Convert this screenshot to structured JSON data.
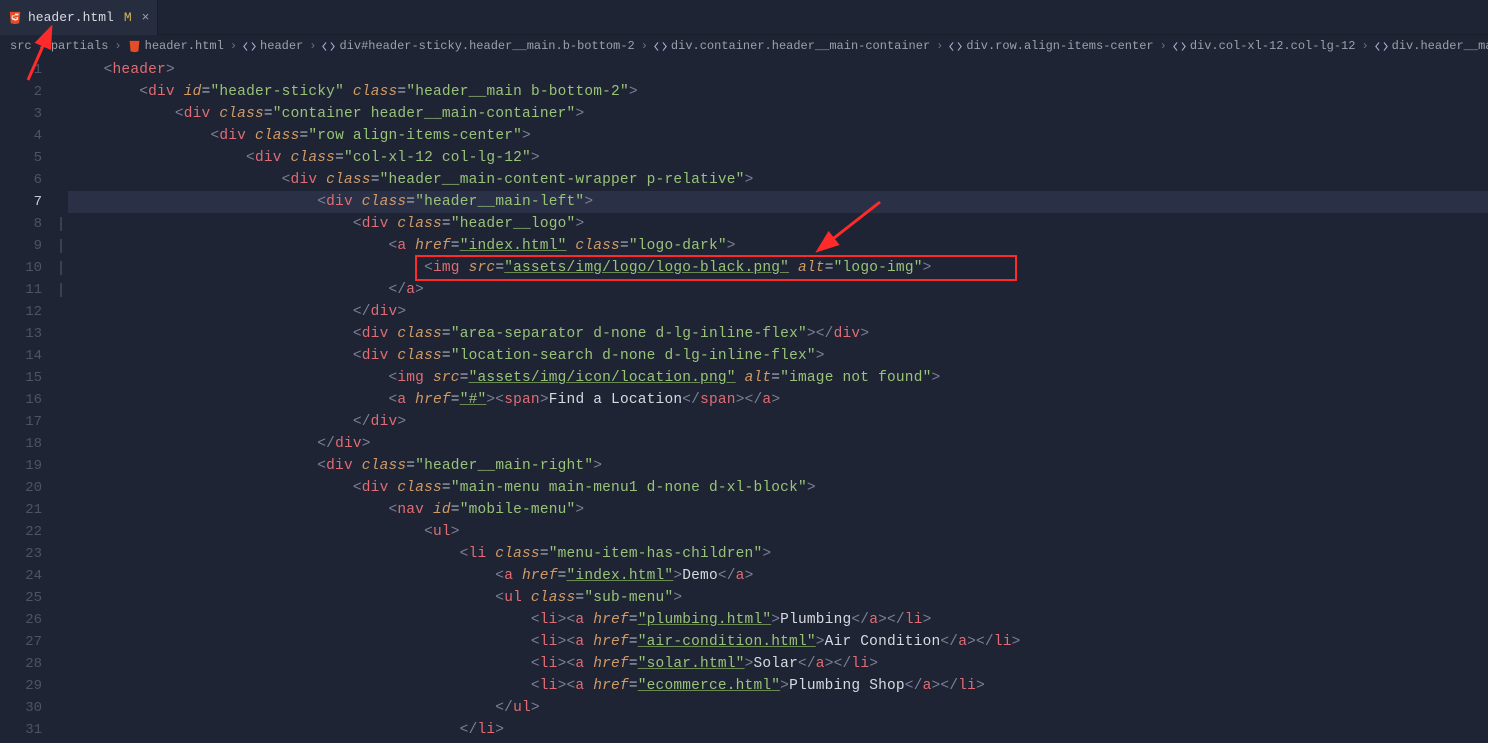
{
  "tab": {
    "filename": "header.html",
    "modified_flag": "M",
    "close_glyph": "×"
  },
  "breadcrumb": {
    "items": [
      {
        "label": "src",
        "icon": ""
      },
      {
        "label": "partials",
        "icon": ""
      },
      {
        "label": "header.html",
        "icon": "html"
      },
      {
        "label": "header",
        "icon": "tag"
      },
      {
        "label": "div#header-sticky.header__main.b-bottom-2",
        "icon": "tag"
      },
      {
        "label": "div.container.header__main-container",
        "icon": "tag"
      },
      {
        "label": "div.row.align-items-center",
        "icon": "tag"
      },
      {
        "label": "div.col-xl-12.col-lg-12",
        "icon": "tag"
      },
      {
        "label": "div.header__main-content-wrapper.p-relative",
        "icon": "tag"
      },
      {
        "label": "d",
        "icon": "tag"
      }
    ]
  },
  "code": [
    {
      "n": 1,
      "indent": 1,
      "tokens": [
        [
          "angle",
          "<"
        ],
        [
          "tag",
          "header"
        ],
        [
          "angle",
          ">"
        ]
      ]
    },
    {
      "n": 2,
      "indent": 2,
      "tokens": [
        [
          "angle",
          "<"
        ],
        [
          "tag",
          "div"
        ],
        [
          "text",
          " "
        ],
        [
          "attr",
          "id"
        ],
        [
          "eq",
          "="
        ],
        [
          "str",
          "\"header-sticky\""
        ],
        [
          "text",
          " "
        ],
        [
          "attr",
          "class"
        ],
        [
          "eq",
          "="
        ],
        [
          "str",
          "\"header__main b-bottom-2\""
        ],
        [
          "angle",
          ">"
        ]
      ]
    },
    {
      "n": 3,
      "indent": 3,
      "tokens": [
        [
          "angle",
          "<"
        ],
        [
          "tag",
          "div"
        ],
        [
          "text",
          " "
        ],
        [
          "attr",
          "class"
        ],
        [
          "eq",
          "="
        ],
        [
          "str",
          "\"container header__main-container\""
        ],
        [
          "angle",
          ">"
        ]
      ]
    },
    {
      "n": 4,
      "indent": 4,
      "tokens": [
        [
          "angle",
          "<"
        ],
        [
          "tag",
          "div"
        ],
        [
          "text",
          " "
        ],
        [
          "attr",
          "class"
        ],
        [
          "eq",
          "="
        ],
        [
          "str",
          "\"row align-items-center\""
        ],
        [
          "angle",
          ">"
        ]
      ]
    },
    {
      "n": 5,
      "indent": 5,
      "tokens": [
        [
          "angle",
          "<"
        ],
        [
          "tag",
          "div"
        ],
        [
          "text",
          " "
        ],
        [
          "attr",
          "class"
        ],
        [
          "eq",
          "="
        ],
        [
          "str",
          "\"col-xl-12 col-lg-12\""
        ],
        [
          "angle",
          ">"
        ]
      ]
    },
    {
      "n": 6,
      "indent": 6,
      "tokens": [
        [
          "angle",
          "<"
        ],
        [
          "tag",
          "div"
        ],
        [
          "text",
          " "
        ],
        [
          "attr",
          "class"
        ],
        [
          "eq",
          "="
        ],
        [
          "str",
          "\"header__main-content-wrapper p-relative\""
        ],
        [
          "angle",
          ">"
        ]
      ]
    },
    {
      "n": 7,
      "indent": 7,
      "hl": true,
      "tokens": [
        [
          "angle",
          "<"
        ],
        [
          "tag",
          "div"
        ],
        [
          "text",
          " "
        ],
        [
          "attr",
          "class"
        ],
        [
          "eq",
          "="
        ],
        [
          "str",
          "\"header__main-left\""
        ],
        [
          "angle",
          ">"
        ]
      ]
    },
    {
      "n": 8,
      "indent": 8,
      "fold": true,
      "tokens": [
        [
          "angle",
          "<"
        ],
        [
          "tag",
          "div"
        ],
        [
          "text",
          " "
        ],
        [
          "attr",
          "class"
        ],
        [
          "eq",
          "="
        ],
        [
          "str",
          "\"header__logo\""
        ],
        [
          "angle",
          ">"
        ]
      ]
    },
    {
      "n": 9,
      "indent": 9,
      "fold": true,
      "tokens": [
        [
          "angle",
          "<"
        ],
        [
          "tag",
          "a"
        ],
        [
          "text",
          " "
        ],
        [
          "attr",
          "href"
        ],
        [
          "eq",
          "="
        ],
        [
          "stru",
          "\"index.html\""
        ],
        [
          "text",
          " "
        ],
        [
          "attr",
          "class"
        ],
        [
          "eq",
          "="
        ],
        [
          "str",
          "\"logo-dark\""
        ],
        [
          "angle",
          ">"
        ]
      ]
    },
    {
      "n": 10,
      "indent": 10,
      "fold": true,
      "tokens": [
        [
          "angle",
          "<"
        ],
        [
          "tag",
          "img"
        ],
        [
          "text",
          " "
        ],
        [
          "attr",
          "src"
        ],
        [
          "eq",
          "="
        ],
        [
          "stru",
          "\"assets/img/logo/logo-black.png\""
        ],
        [
          "text",
          " "
        ],
        [
          "attr",
          "alt"
        ],
        [
          "eq",
          "="
        ],
        [
          "str",
          "\"logo-img\""
        ],
        [
          "angle",
          ">"
        ]
      ]
    },
    {
      "n": 11,
      "indent": 9,
      "fold": true,
      "tokens": [
        [
          "angle",
          "</"
        ],
        [
          "tag",
          "a"
        ],
        [
          "angle",
          ">"
        ]
      ]
    },
    {
      "n": 12,
      "indent": 8,
      "tokens": [
        [
          "angle",
          "</"
        ],
        [
          "tag",
          "div"
        ],
        [
          "angle",
          ">"
        ]
      ]
    },
    {
      "n": 13,
      "indent": 8,
      "tokens": [
        [
          "angle",
          "<"
        ],
        [
          "tag",
          "div"
        ],
        [
          "text",
          " "
        ],
        [
          "attr",
          "class"
        ],
        [
          "eq",
          "="
        ],
        [
          "str",
          "\"area-separator d-none d-lg-inline-flex\""
        ],
        [
          "angle",
          "></"
        ],
        [
          "tag",
          "div"
        ],
        [
          "angle",
          ">"
        ]
      ]
    },
    {
      "n": 14,
      "indent": 8,
      "tokens": [
        [
          "angle",
          "<"
        ],
        [
          "tag",
          "div"
        ],
        [
          "text",
          " "
        ],
        [
          "attr",
          "class"
        ],
        [
          "eq",
          "="
        ],
        [
          "str",
          "\"location-search d-none d-lg-inline-flex\""
        ],
        [
          "angle",
          ">"
        ]
      ]
    },
    {
      "n": 15,
      "indent": 9,
      "tokens": [
        [
          "angle",
          "<"
        ],
        [
          "tag",
          "img"
        ],
        [
          "text",
          " "
        ],
        [
          "attr",
          "src"
        ],
        [
          "eq",
          "="
        ],
        [
          "stru",
          "\"assets/img/icon/location.png\""
        ],
        [
          "text",
          " "
        ],
        [
          "attr",
          "alt"
        ],
        [
          "eq",
          "="
        ],
        [
          "str",
          "\"image not found\""
        ],
        [
          "angle",
          ">"
        ]
      ]
    },
    {
      "n": 16,
      "indent": 9,
      "tokens": [
        [
          "angle",
          "<"
        ],
        [
          "tag",
          "a"
        ],
        [
          "text",
          " "
        ],
        [
          "attr",
          "href"
        ],
        [
          "eq",
          "="
        ],
        [
          "stru",
          "\"#\""
        ],
        [
          "angle",
          "><"
        ],
        [
          "tag",
          "span"
        ],
        [
          "angle",
          ">"
        ],
        [
          "text",
          "Find a Location"
        ],
        [
          "angle",
          "</"
        ],
        [
          "tag",
          "span"
        ],
        [
          "angle",
          "></"
        ],
        [
          "tag",
          "a"
        ],
        [
          "angle",
          ">"
        ]
      ]
    },
    {
      "n": 17,
      "indent": 8,
      "tokens": [
        [
          "angle",
          "</"
        ],
        [
          "tag",
          "div"
        ],
        [
          "angle",
          ">"
        ]
      ]
    },
    {
      "n": 18,
      "indent": 7,
      "tokens": [
        [
          "angle",
          "</"
        ],
        [
          "tag",
          "div"
        ],
        [
          "angle",
          ">"
        ]
      ]
    },
    {
      "n": 19,
      "indent": 7,
      "tokens": [
        [
          "angle",
          "<"
        ],
        [
          "tag",
          "div"
        ],
        [
          "text",
          " "
        ],
        [
          "attr",
          "class"
        ],
        [
          "eq",
          "="
        ],
        [
          "str",
          "\"header__main-right\""
        ],
        [
          "angle",
          ">"
        ]
      ]
    },
    {
      "n": 20,
      "indent": 8,
      "tokens": [
        [
          "angle",
          "<"
        ],
        [
          "tag",
          "div"
        ],
        [
          "text",
          " "
        ],
        [
          "attr",
          "class"
        ],
        [
          "eq",
          "="
        ],
        [
          "str",
          "\"main-menu main-menu1 d-none d-xl-block\""
        ],
        [
          "angle",
          ">"
        ]
      ]
    },
    {
      "n": 21,
      "indent": 9,
      "tokens": [
        [
          "angle",
          "<"
        ],
        [
          "tag",
          "nav"
        ],
        [
          "text",
          " "
        ],
        [
          "attr",
          "id"
        ],
        [
          "eq",
          "="
        ],
        [
          "str",
          "\"mobile-menu\""
        ],
        [
          "angle",
          ">"
        ]
      ]
    },
    {
      "n": 22,
      "indent": 10,
      "tokens": [
        [
          "angle",
          "<"
        ],
        [
          "tag",
          "ul"
        ],
        [
          "angle",
          ">"
        ]
      ]
    },
    {
      "n": 23,
      "indent": 11,
      "tokens": [
        [
          "angle",
          "<"
        ],
        [
          "tag",
          "li"
        ],
        [
          "text",
          " "
        ],
        [
          "attr",
          "class"
        ],
        [
          "eq",
          "="
        ],
        [
          "str",
          "\"menu-item-has-children\""
        ],
        [
          "angle",
          ">"
        ]
      ]
    },
    {
      "n": 24,
      "indent": 12,
      "tokens": [
        [
          "angle",
          "<"
        ],
        [
          "tag",
          "a"
        ],
        [
          "text",
          " "
        ],
        [
          "attr",
          "href"
        ],
        [
          "eq",
          "="
        ],
        [
          "stru",
          "\"index.html\""
        ],
        [
          "angle",
          ">"
        ],
        [
          "text",
          "Demo"
        ],
        [
          "angle",
          "</"
        ],
        [
          "tag",
          "a"
        ],
        [
          "angle",
          ">"
        ]
      ]
    },
    {
      "n": 25,
      "indent": 12,
      "tokens": [
        [
          "angle",
          "<"
        ],
        [
          "tag",
          "ul"
        ],
        [
          "text",
          " "
        ],
        [
          "attr",
          "class"
        ],
        [
          "eq",
          "="
        ],
        [
          "str",
          "\"sub-menu\""
        ],
        [
          "angle",
          ">"
        ]
      ]
    },
    {
      "n": 26,
      "indent": 13,
      "tokens": [
        [
          "angle",
          "<"
        ],
        [
          "tag",
          "li"
        ],
        [
          "angle",
          "><"
        ],
        [
          "tag",
          "a"
        ],
        [
          "text",
          " "
        ],
        [
          "attr",
          "href"
        ],
        [
          "eq",
          "="
        ],
        [
          "stru",
          "\"plumbing.html\""
        ],
        [
          "angle",
          ">"
        ],
        [
          "text",
          "Plumbing"
        ],
        [
          "angle",
          "</"
        ],
        [
          "tag",
          "a"
        ],
        [
          "angle",
          "></"
        ],
        [
          "tag",
          "li"
        ],
        [
          "angle",
          ">"
        ]
      ]
    },
    {
      "n": 27,
      "indent": 13,
      "tokens": [
        [
          "angle",
          "<"
        ],
        [
          "tag",
          "li"
        ],
        [
          "angle",
          "><"
        ],
        [
          "tag",
          "a"
        ],
        [
          "text",
          " "
        ],
        [
          "attr",
          "href"
        ],
        [
          "eq",
          "="
        ],
        [
          "stru",
          "\"air-condition.html\""
        ],
        [
          "angle",
          ">"
        ],
        [
          "text",
          "Air Condition"
        ],
        [
          "angle",
          "</"
        ],
        [
          "tag",
          "a"
        ],
        [
          "angle",
          "></"
        ],
        [
          "tag",
          "li"
        ],
        [
          "angle",
          ">"
        ]
      ]
    },
    {
      "n": 28,
      "indent": 13,
      "tokens": [
        [
          "angle",
          "<"
        ],
        [
          "tag",
          "li"
        ],
        [
          "angle",
          "><"
        ],
        [
          "tag",
          "a"
        ],
        [
          "text",
          " "
        ],
        [
          "attr",
          "href"
        ],
        [
          "eq",
          "="
        ],
        [
          "stru",
          "\"solar.html\""
        ],
        [
          "angle",
          ">"
        ],
        [
          "text",
          "Solar"
        ],
        [
          "angle",
          "</"
        ],
        [
          "tag",
          "a"
        ],
        [
          "angle",
          "></"
        ],
        [
          "tag",
          "li"
        ],
        [
          "angle",
          ">"
        ]
      ]
    },
    {
      "n": 29,
      "indent": 13,
      "tokens": [
        [
          "angle",
          "<"
        ],
        [
          "tag",
          "li"
        ],
        [
          "angle",
          "><"
        ],
        [
          "tag",
          "a"
        ],
        [
          "text",
          " "
        ],
        [
          "attr",
          "href"
        ],
        [
          "eq",
          "="
        ],
        [
          "stru",
          "\"ecommerce.html\""
        ],
        [
          "angle",
          ">"
        ],
        [
          "text",
          "Plumbing Shop"
        ],
        [
          "angle",
          "</"
        ],
        [
          "tag",
          "a"
        ],
        [
          "angle",
          "></"
        ],
        [
          "tag",
          "li"
        ],
        [
          "angle",
          ">"
        ]
      ]
    },
    {
      "n": 30,
      "indent": 12,
      "tokens": [
        [
          "angle",
          "</"
        ],
        [
          "tag",
          "ul"
        ],
        [
          "angle",
          ">"
        ]
      ]
    },
    {
      "n": 31,
      "indent": 11,
      "tokens": [
        [
          "angle",
          "</"
        ],
        [
          "tag",
          "li"
        ],
        [
          "angle",
          ">"
        ]
      ]
    }
  ]
}
